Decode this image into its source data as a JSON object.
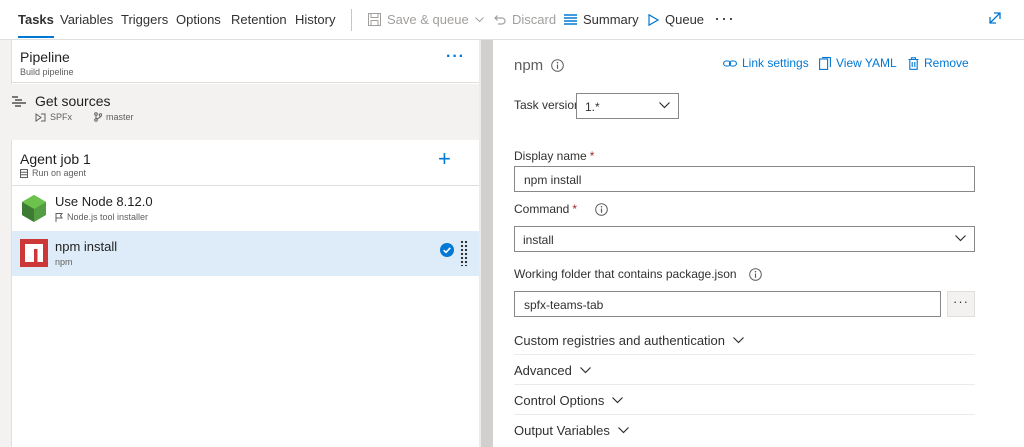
{
  "tabs": [
    {
      "label": "Tasks",
      "active": true
    },
    {
      "label": "Variables"
    },
    {
      "label": "Triggers"
    },
    {
      "label": "Options"
    },
    {
      "label": "Retention"
    },
    {
      "label": "History"
    }
  ],
  "toolbar": {
    "save_queue": "Save & queue",
    "discard": "Discard",
    "summary": "Summary",
    "queue": "Queue",
    "more": "···"
  },
  "pipeline": {
    "title": "Pipeline",
    "subtitle": "Build pipeline",
    "more": "···"
  },
  "sources": {
    "title": "Get sources",
    "repo": "SPFx",
    "branch": "master"
  },
  "agent_job": {
    "title": "Agent job 1",
    "subtitle": "Run on agent",
    "add": "+"
  },
  "tasks": [
    {
      "title": "Use Node 8.12.0",
      "subtitle": "Node.js tool installer",
      "icon": "nodejs-icon",
      "selected": false
    },
    {
      "title": "npm install",
      "subtitle": "npm",
      "icon": "npm-icon",
      "selected": true
    }
  ],
  "detail": {
    "title": "npm",
    "link_settings": "Link settings",
    "view_yaml": "View YAML",
    "remove": "Remove",
    "task_version_label": "Task version",
    "task_version_value": "1.*",
    "display_name_label": "Display name",
    "display_name_value": "npm install",
    "command_label": "Command",
    "command_value": "install",
    "working_folder_label": "Working folder that contains package.json",
    "working_folder_value": "spfx-teams-tab",
    "browse": "···",
    "required_mark": "*",
    "sections": [
      "Custom registries and authentication",
      "Advanced",
      "Control Options",
      "Output Variables"
    ]
  },
  "colors": {
    "accent": "#0078d4",
    "selected_row": "#deecf9",
    "required": "#a4262c",
    "npm_red": "#cb3837",
    "node_green": "#539e43"
  }
}
